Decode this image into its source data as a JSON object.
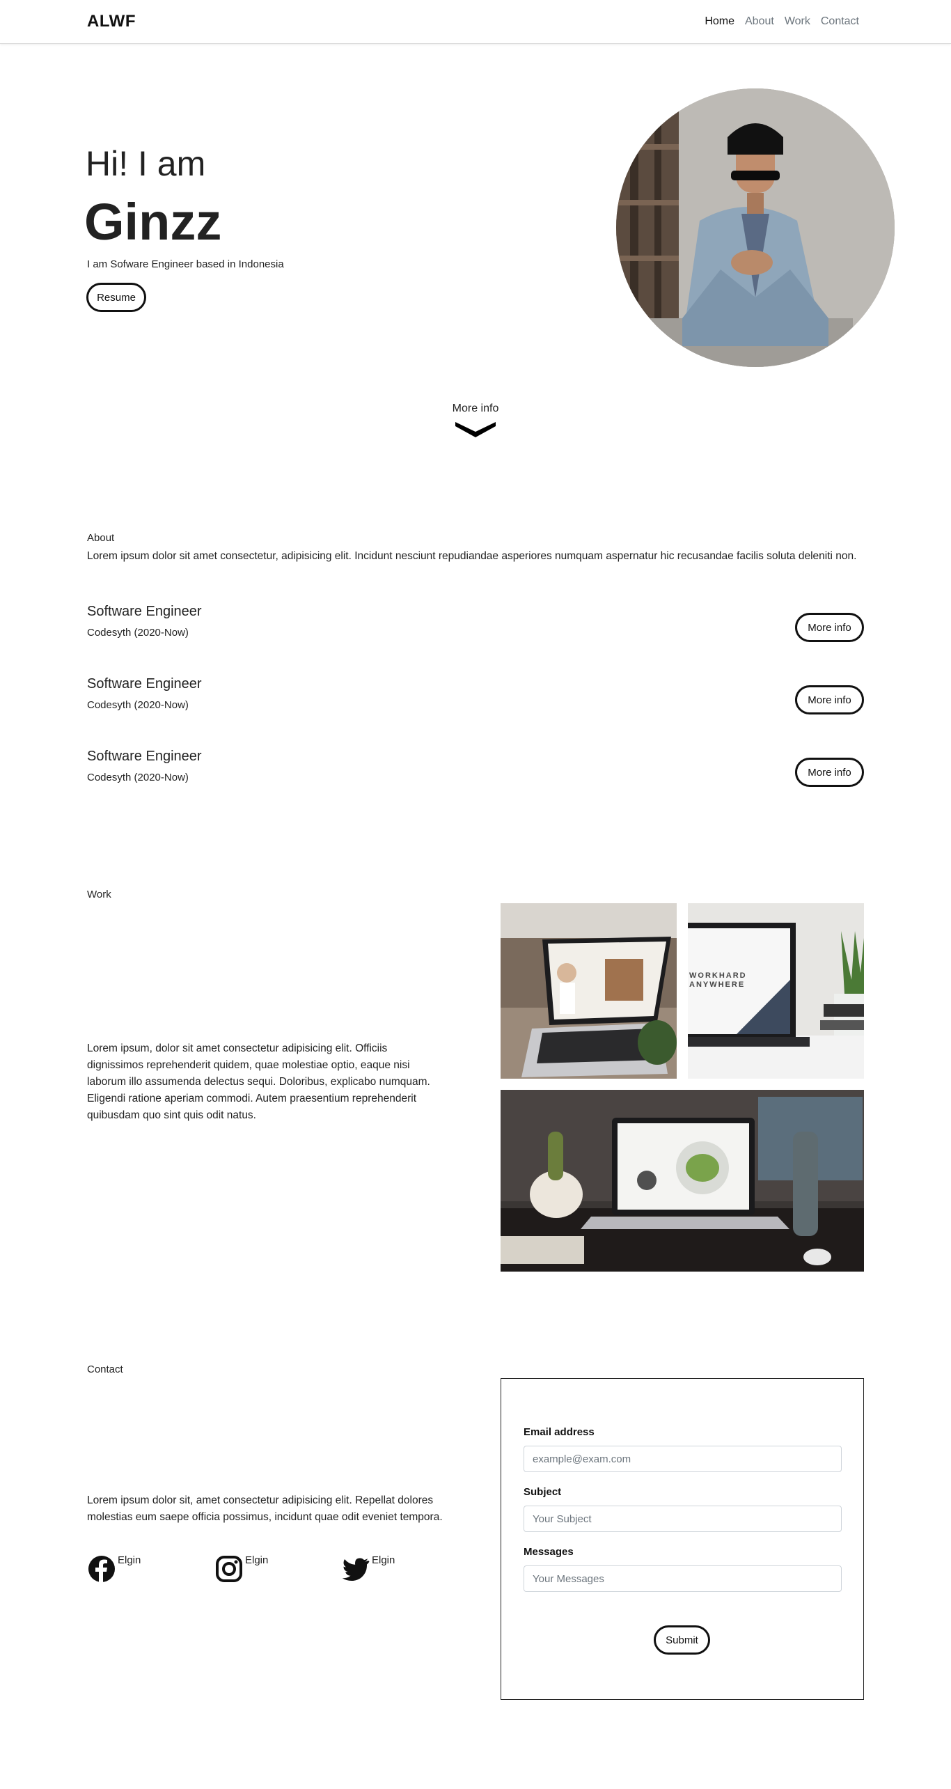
{
  "nav": {
    "brand": "ALWF",
    "links": [
      "Home",
      "About",
      "Work",
      "Contact"
    ]
  },
  "hero": {
    "greeting": "Hi! I am",
    "name": "Ginzz",
    "subtitle": "I am Sofware Engineer based in Indonesia",
    "resume_label": "Resume",
    "more_info": "More info"
  },
  "about": {
    "label": "About",
    "text": "Lorem ipsum dolor sit amet consectetur, adipisicing elit. Incidunt nesciunt repudiandae asperiores numquam aspernatur hic recusandae facilis soluta deleniti non.",
    "jobs": [
      {
        "title": "Software Engineer",
        "company": "Codesyth (2020-Now)",
        "button": "More info"
      },
      {
        "title": "Software Engineer",
        "company": "Codesyth (2020-Now)",
        "button": "More info"
      },
      {
        "title": "Software Engineer",
        "company": "Codesyth (2020-Now)",
        "button": "More info"
      }
    ]
  },
  "work": {
    "label": "Work",
    "text": "Lorem ipsum, dolor sit amet consectetur adipisicing elit. Officiis dignissimos reprehenderit quidem, quae molestiae optio, eaque nisi laborum illo assumenda delectus sequi. Doloribus, explicabo numquam. Eligendi ratione aperiam commodi. Autem praesentium reprehenderit quibusdam quo sint quis odit natus.",
    "image2_caption": "WORKHARD ANYWHERE"
  },
  "contact": {
    "label": "Contact",
    "text": "Lorem ipsum dolor sit, amet consectetur adipisicing elit. Repellat dolores molestias eum saepe officia possimus, incidunt quae odit eveniet tempora.",
    "socials": [
      {
        "icon": "facebook-icon",
        "handle": "Elgin"
      },
      {
        "icon": "instagram-icon",
        "handle": "Elgin"
      },
      {
        "icon": "twitter-icon",
        "handle": "Elgin"
      }
    ],
    "form": {
      "email_label": "Email address",
      "email_placeholder": "example@exam.com",
      "subject_label": "Subject",
      "subject_placeholder": "Your Subject",
      "messages_label": "Messages",
      "messages_placeholder": "Your Messages",
      "submit_label": "Submit"
    }
  }
}
